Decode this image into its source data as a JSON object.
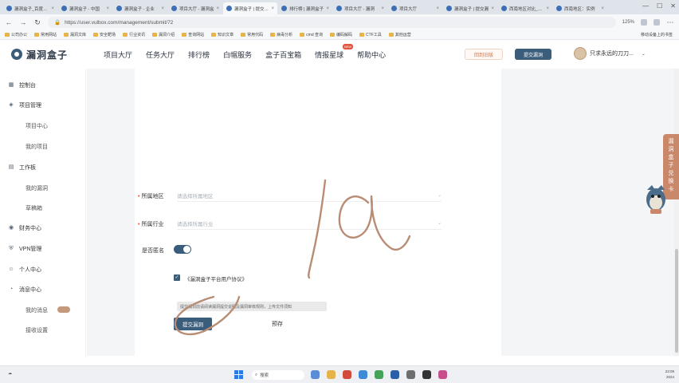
{
  "browser": {
    "tabs": [
      {
        "title": "漏洞盒子_百度搜索",
        "active": false
      },
      {
        "title": "漏洞盒子 - 中国",
        "active": false
      },
      {
        "title": "漏洞盒子 - 企业",
        "active": false
      },
      {
        "title": "项目大厅 - 漏洞盒",
        "active": false
      },
      {
        "title": "漏洞盒子 | 提交漏洞",
        "active": true
      },
      {
        "title": "排行榜 | 漏洞盒子",
        "active": false
      },
      {
        "title": "项目大厅 - 漏洞",
        "active": false
      },
      {
        "title": "项目大厅",
        "active": false
      },
      {
        "title": "漏洞盒子 | 提交漏",
        "active": false
      },
      {
        "title": "西南地区对比_百度",
        "active": false
      },
      {
        "title": "西南地区：实例",
        "active": false
      }
    ],
    "url": "https://user.vulbox.com/management/submit/72",
    "zoom": "125%",
    "bookmarks": [
      "公司办公",
      "常用网站",
      "漏洞文库",
      "安全靶场",
      "行业资讯",
      "漏洞介绍",
      "查询网站",
      "知识文章",
      "常用代码",
      "病毒分析",
      "cmd 查询",
      "编码解码",
      "CTF工具",
      "其他运营"
    ],
    "bookmarks_right": "移动设备上的书签"
  },
  "site": {
    "logo_text": "漏洞盒子",
    "nav": [
      {
        "label": "项目大厅"
      },
      {
        "label": "任务大厅"
      },
      {
        "label": "排行榜"
      },
      {
        "label": "白帽服务"
      },
      {
        "label": "盒子百宝箱"
      },
      {
        "label": "情报星球",
        "badge": "NEW"
      },
      {
        "label": "帮助中心"
      }
    ],
    "pill_1": "回到旧版",
    "pill_2": "提交漏洞",
    "username": "只求永远的刀刀..."
  },
  "sidebar": {
    "groups": [
      {
        "label": "控制台",
        "icon": "dashboard-icon"
      },
      {
        "label": "项目管理",
        "icon": "cube-icon",
        "children": [
          "项目中心",
          "我的项目"
        ]
      },
      {
        "label": "工作板",
        "icon": "board-icon",
        "children": [
          "我的漏洞",
          "草稿箱"
        ]
      },
      {
        "label": "财务中心",
        "icon": "wallet-icon"
      },
      {
        "label": "VPN管理",
        "icon": "vpn-icon"
      },
      {
        "label": "个人中心",
        "icon": "user-icon"
      },
      {
        "label": "消息中心",
        "icon": "bell-icon",
        "children": [
          "我的消息",
          "接收设置"
        ]
      }
    ]
  },
  "form": {
    "region_label": "所属地区",
    "region_placeholder": "请选择所属地区",
    "industry_label": "所属行业",
    "industry_placeholder": "请选择所属行业",
    "anonymous_label": "是否匿名",
    "anonymous_on": true,
    "agree_checked": true,
    "agree_text": "《漏洞盒子平台用户协议》",
    "notice_text": "提交漏洞前请阅读漏洞提交说明及漏洞审核规则，上传文件须知",
    "submit_label": "提交漏洞",
    "save_label": "预存"
  },
  "float_card": {
    "text": "漏洞盒子兑换卡"
  },
  "taskbar": {
    "search_placeholder": "搜索",
    "time": "23:09",
    "date": "2024"
  },
  "colors": {
    "brand": "#3b5d7c",
    "accent": "#c9886a",
    "ink": "#b88d74"
  }
}
